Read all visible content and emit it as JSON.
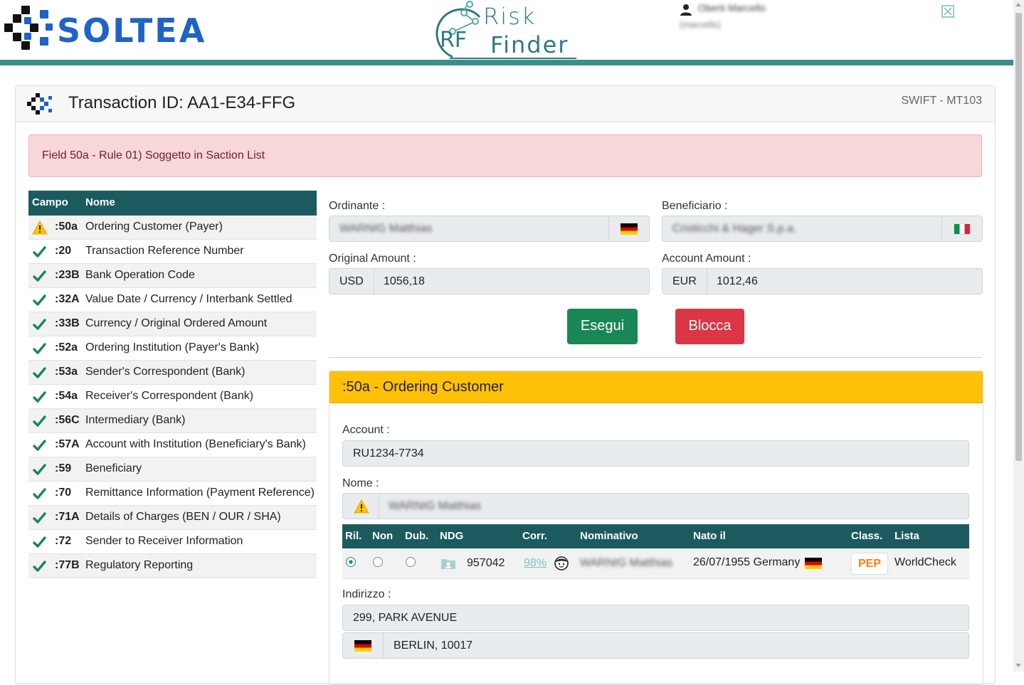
{
  "header": {
    "brand": "SOLTEA",
    "product_line1": "Risk",
    "product_line2": "Finder",
    "product_mono": "RF",
    "user_name": "Oberti Marcello",
    "user_login": "(marcello)"
  },
  "card": {
    "title": "Transaction ID: AA1-E34-FFG",
    "message_type": "SWIFT - MT103"
  },
  "alert": {
    "text": "Field 50a - Rule 01) Soggetto in Saction List"
  },
  "fields_table": {
    "headers": [
      "Campo",
      "Nome"
    ],
    "rows": [
      {
        "status": "warning",
        "code": ":50a",
        "name": "Ordering Customer (Payer)"
      },
      {
        "status": "ok",
        "code": ":20",
        "name": "Transaction Reference Number"
      },
      {
        "status": "ok",
        "code": ":23B",
        "name": "Bank Operation Code"
      },
      {
        "status": "ok",
        "code": ":32A",
        "name": "Value Date / Currency / Interbank Settled"
      },
      {
        "status": "ok",
        "code": ":33B",
        "name": "Currency / Original Ordered Amount"
      },
      {
        "status": "ok",
        "code": ":52a",
        "name": "Ordering Institution (Payer's Bank)"
      },
      {
        "status": "ok",
        "code": ":53a",
        "name": "Sender's Correspondent (Bank)"
      },
      {
        "status": "ok",
        "code": ":54a",
        "name": "Receiver's Correspondent (Bank)"
      },
      {
        "status": "ok",
        "code": ":56C",
        "name": "Intermediary (Bank)"
      },
      {
        "status": "ok",
        "code": ":57A",
        "name": "Account with Institution (Beneficiary's Bank)"
      },
      {
        "status": "ok",
        "code": ":59",
        "name": "Beneficiary"
      },
      {
        "status": "ok",
        "code": ":70",
        "name": "Remittance Information (Payment Reference)"
      },
      {
        "status": "ok",
        "code": ":71A",
        "name": "Details of Charges (BEN / OUR / SHA)"
      },
      {
        "status": "ok",
        "code": ":72",
        "name": "Sender to Receiver Information"
      },
      {
        "status": "ok",
        "code": ":77B",
        "name": "Regulatory Reporting"
      }
    ]
  },
  "summary": {
    "ordinante_label": "Ordinante :",
    "ordinante_value": "WARNIG Matthias",
    "beneficiario_label": "Beneficiario :",
    "beneficiario_value": "Cristicchi & Hager S.p.a.",
    "original_amount_label": "Original Amount :",
    "original_currency": "USD",
    "original_amount": "1056,18",
    "account_amount_label": "Account Amount :",
    "account_currency": "EUR",
    "account_amount": "1012,46",
    "execute_label": "Esegui",
    "block_label": "Blocca"
  },
  "detail": {
    "title": ":50a - Ordering Customer",
    "account_label": "Account :",
    "account_value": "RU1234-7734",
    "nome_label": "Nome :",
    "nome_value": "WARNIG Matthias",
    "match_headers": [
      "Ril.",
      "Non",
      "Dub.",
      "NDG",
      "Corr.",
      "Nominativo",
      "Nato il",
      "Class.",
      "Lista"
    ],
    "match_row": {
      "ndg": "957042",
      "corr": "98%",
      "nominativo": "WARNIG Matthias",
      "nato_il": "26/07/1955 Germany",
      "class": "PEP",
      "lista": "WorldCheck"
    },
    "indirizzo_label": "Indirizzo :",
    "address_line1": "299, PARK AVENUE",
    "address_line2": "BERLIN, 10017"
  },
  "colors": {
    "teal_dark": "#1b5b5f",
    "brand_blue": "#1e63c6",
    "warning_yellow": "#ffc107",
    "success_green": "#198754",
    "danger_red": "#dc3545",
    "alert_bg": "#f8d7da"
  }
}
